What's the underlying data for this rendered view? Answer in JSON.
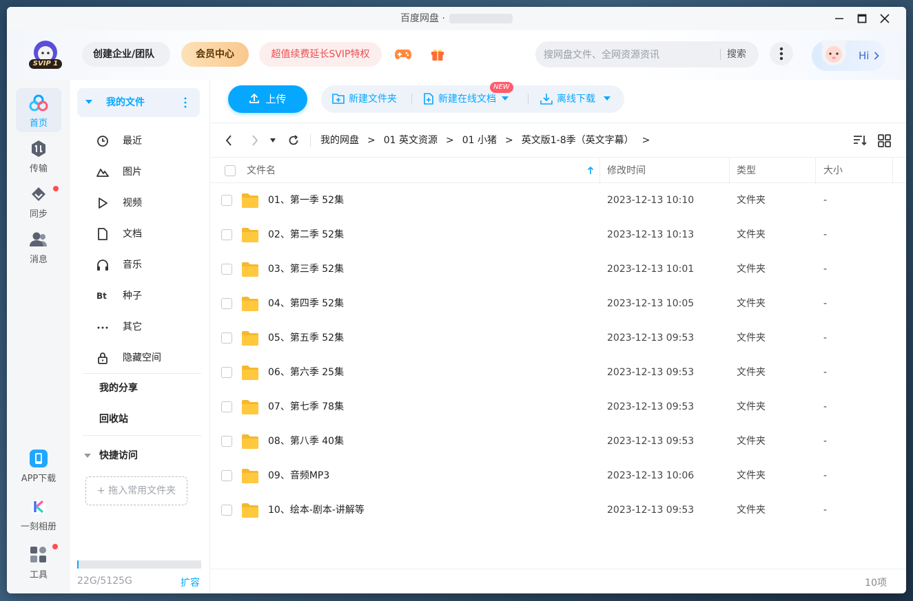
{
  "window": {
    "title": "百度网盘 ·"
  },
  "header": {
    "badge_text": "SVIP 1",
    "team_button": "创建企业/团队",
    "vip_button": "会员中心",
    "renew_button": "超值续费延长SVIP特权",
    "search_placeholder": "搜网盘文件、全网资源资讯",
    "search_button": "搜索",
    "hi_text": "Hi"
  },
  "nav": {
    "items": [
      {
        "label": "首页"
      },
      {
        "label": "传输"
      },
      {
        "label": "同步"
      },
      {
        "label": "消息"
      }
    ],
    "bottom": [
      {
        "label": "APP下载"
      },
      {
        "label": "一刻相册"
      },
      {
        "label": "工具"
      }
    ]
  },
  "sidebar": {
    "my_files": "我的文件",
    "categories": [
      {
        "label": "最近",
        "icon": "clock-icon"
      },
      {
        "label": "图片",
        "icon": "image-icon"
      },
      {
        "label": "视频",
        "icon": "play-icon"
      },
      {
        "label": "文档",
        "icon": "document-icon"
      },
      {
        "label": "音乐",
        "icon": "headphones-icon"
      },
      {
        "label": "种子",
        "icon": "bt-icon",
        "glyph": "Bt"
      },
      {
        "label": "其它",
        "icon": "more-icon"
      },
      {
        "label": "隐藏空间",
        "icon": "lock-icon"
      }
    ],
    "my_share": "我的分享",
    "recycle": "回收站",
    "quick_access": "快捷访问",
    "drop_hint": "+ 拖入常用文件夹",
    "quota": {
      "used_gb": 22,
      "total_gb": 5125,
      "text": "22G/5125G",
      "expand": "扩容"
    }
  },
  "toolbar": {
    "upload": "上传",
    "new_folder": "新建文件夹",
    "new_doc": "新建在线文档",
    "new_badge": "NEW",
    "offline_download": "离线下载"
  },
  "breadcrumb": [
    "我的网盘",
    "01 英文资源",
    "01 小猪",
    "英文版1-8季（英文字幕）"
  ],
  "table": {
    "headers": {
      "name": "文件名",
      "mtime": "修改时间",
      "type": "类型",
      "size": "大小"
    },
    "rows": [
      {
        "name": "01、第一季 52集",
        "mtime": "2023-12-13 10:10",
        "type": "文件夹",
        "size": "-"
      },
      {
        "name": "02、第二季 52集",
        "mtime": "2023-12-13 10:13",
        "type": "文件夹",
        "size": "-"
      },
      {
        "name": "03、第三季 52集",
        "mtime": "2023-12-13 10:01",
        "type": "文件夹",
        "size": "-"
      },
      {
        "name": "04、第四季 52集",
        "mtime": "2023-12-13 10:05",
        "type": "文件夹",
        "size": "-"
      },
      {
        "name": "05、第五季 52集",
        "mtime": "2023-12-13 09:53",
        "type": "文件夹",
        "size": "-"
      },
      {
        "name": "06、第六季 25集",
        "mtime": "2023-12-13 09:53",
        "type": "文件夹",
        "size": "-"
      },
      {
        "name": "07、第七季 78集",
        "mtime": "2023-12-13 09:53",
        "type": "文件夹",
        "size": "-"
      },
      {
        "name": "08、第八季 40集",
        "mtime": "2023-12-13 09:53",
        "type": "文件夹",
        "size": "-"
      },
      {
        "name": "09、音频MP3",
        "mtime": "2023-12-13 10:06",
        "type": "文件夹",
        "size": "-"
      },
      {
        "name": "10、绘本-剧本-讲解等",
        "mtime": "2023-12-13 09:53",
        "type": "文件夹",
        "size": "-"
      }
    ]
  },
  "footer": {
    "count": "10项"
  },
  "colors": {
    "accent": "#06a7ff",
    "folder": "#ffc83d",
    "danger": "#ff4d4f"
  }
}
